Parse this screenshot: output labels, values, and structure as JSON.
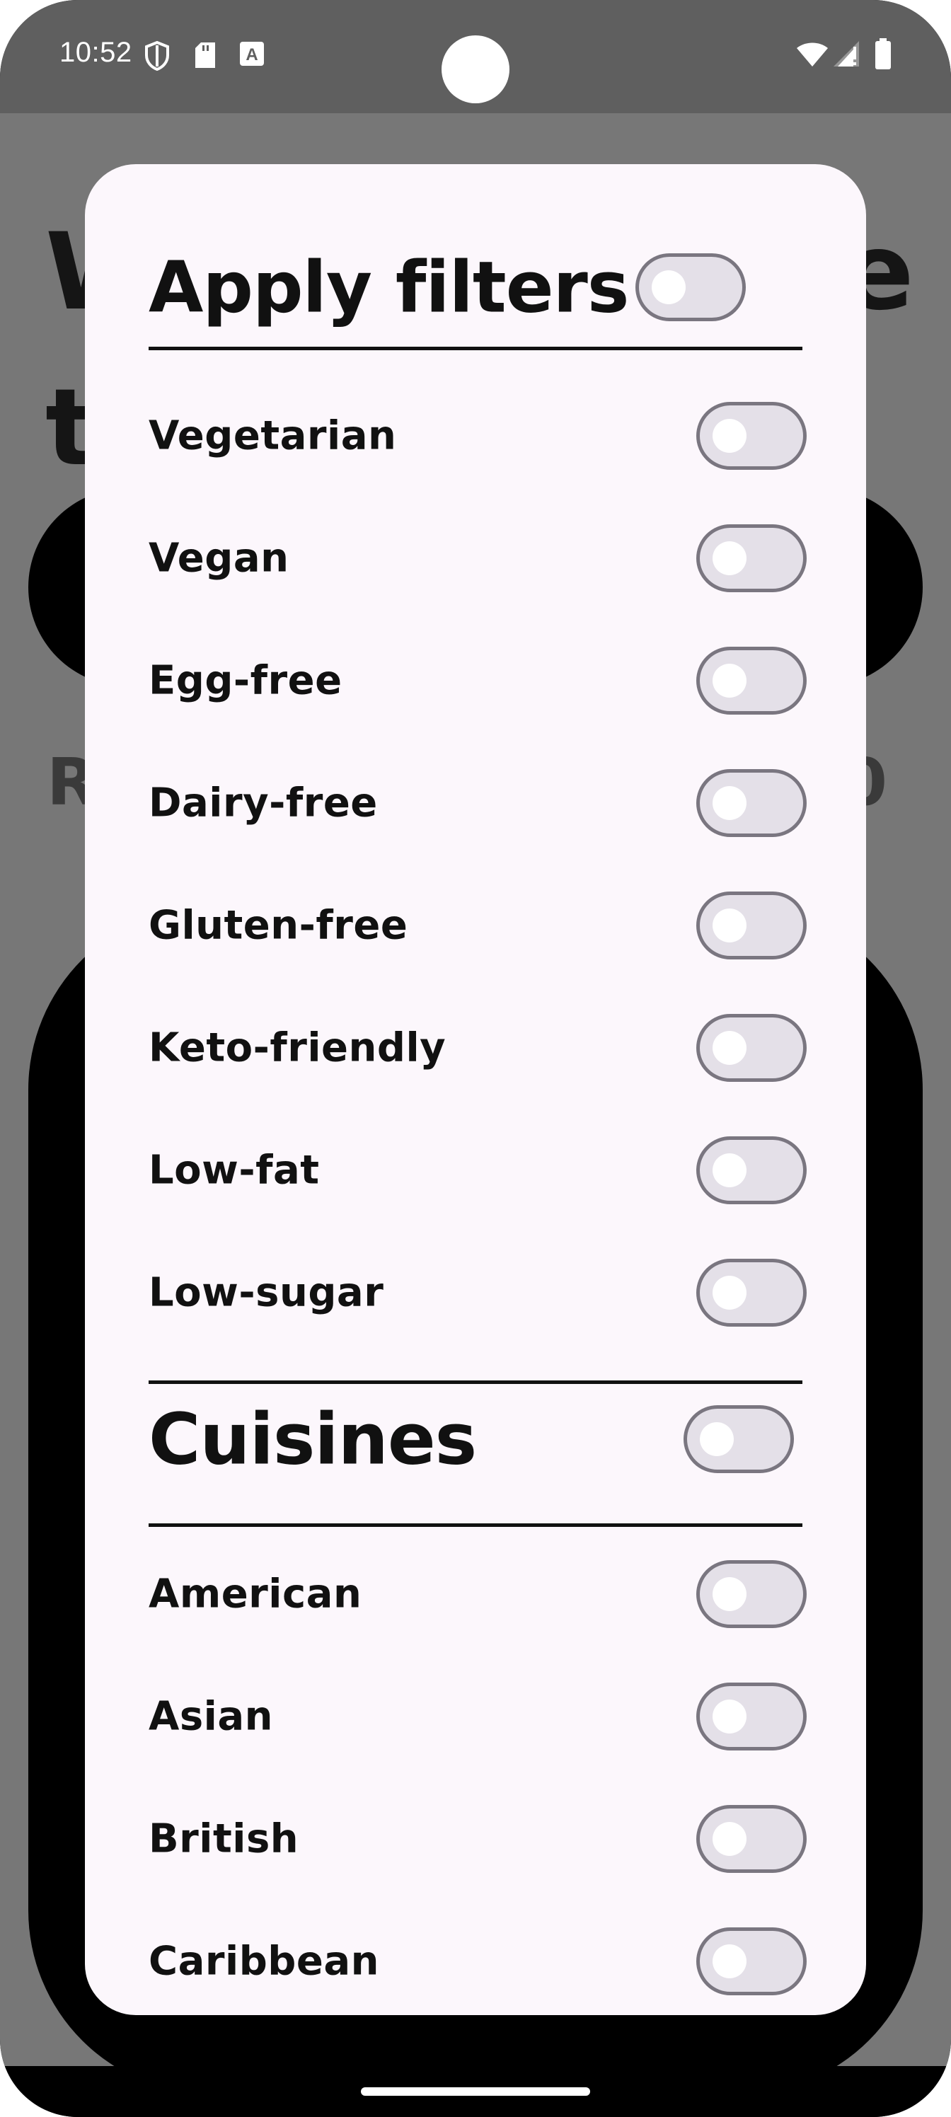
{
  "status_bar": {
    "time": "10:52",
    "left_icons": [
      "shield-icon",
      "sd-card-icon",
      "keyboard-a-icon"
    ],
    "right_icons": [
      "wifi-icon",
      "signal-icon",
      "battery-icon"
    ]
  },
  "background_app": {
    "title_line1_left": "W",
    "title_line1_right": "e",
    "title_line2_left": "t",
    "subtitle_left": "R",
    "subtitle_right": "0"
  },
  "dialog": {
    "apply_filters": {
      "title": "Apply filters",
      "enabled": false
    },
    "filters": [
      {
        "label": "Vegetarian",
        "enabled": false
      },
      {
        "label": "Vegan",
        "enabled": false
      },
      {
        "label": "Egg-free",
        "enabled": false
      },
      {
        "label": "Dairy-free",
        "enabled": false
      },
      {
        "label": "Gluten-free",
        "enabled": false
      },
      {
        "label": "Keto-friendly",
        "enabled": false
      },
      {
        "label": "Low-fat",
        "enabled": false
      },
      {
        "label": "Low-sugar",
        "enabled": false
      }
    ],
    "cuisines": {
      "title": "Cuisines",
      "enabled": false
    },
    "cuisine_items": [
      {
        "label": "American",
        "enabled": false
      },
      {
        "label": "Asian",
        "enabled": false
      },
      {
        "label": "British",
        "enabled": false
      },
      {
        "label": "Caribbean",
        "enabled": false
      }
    ]
  }
}
